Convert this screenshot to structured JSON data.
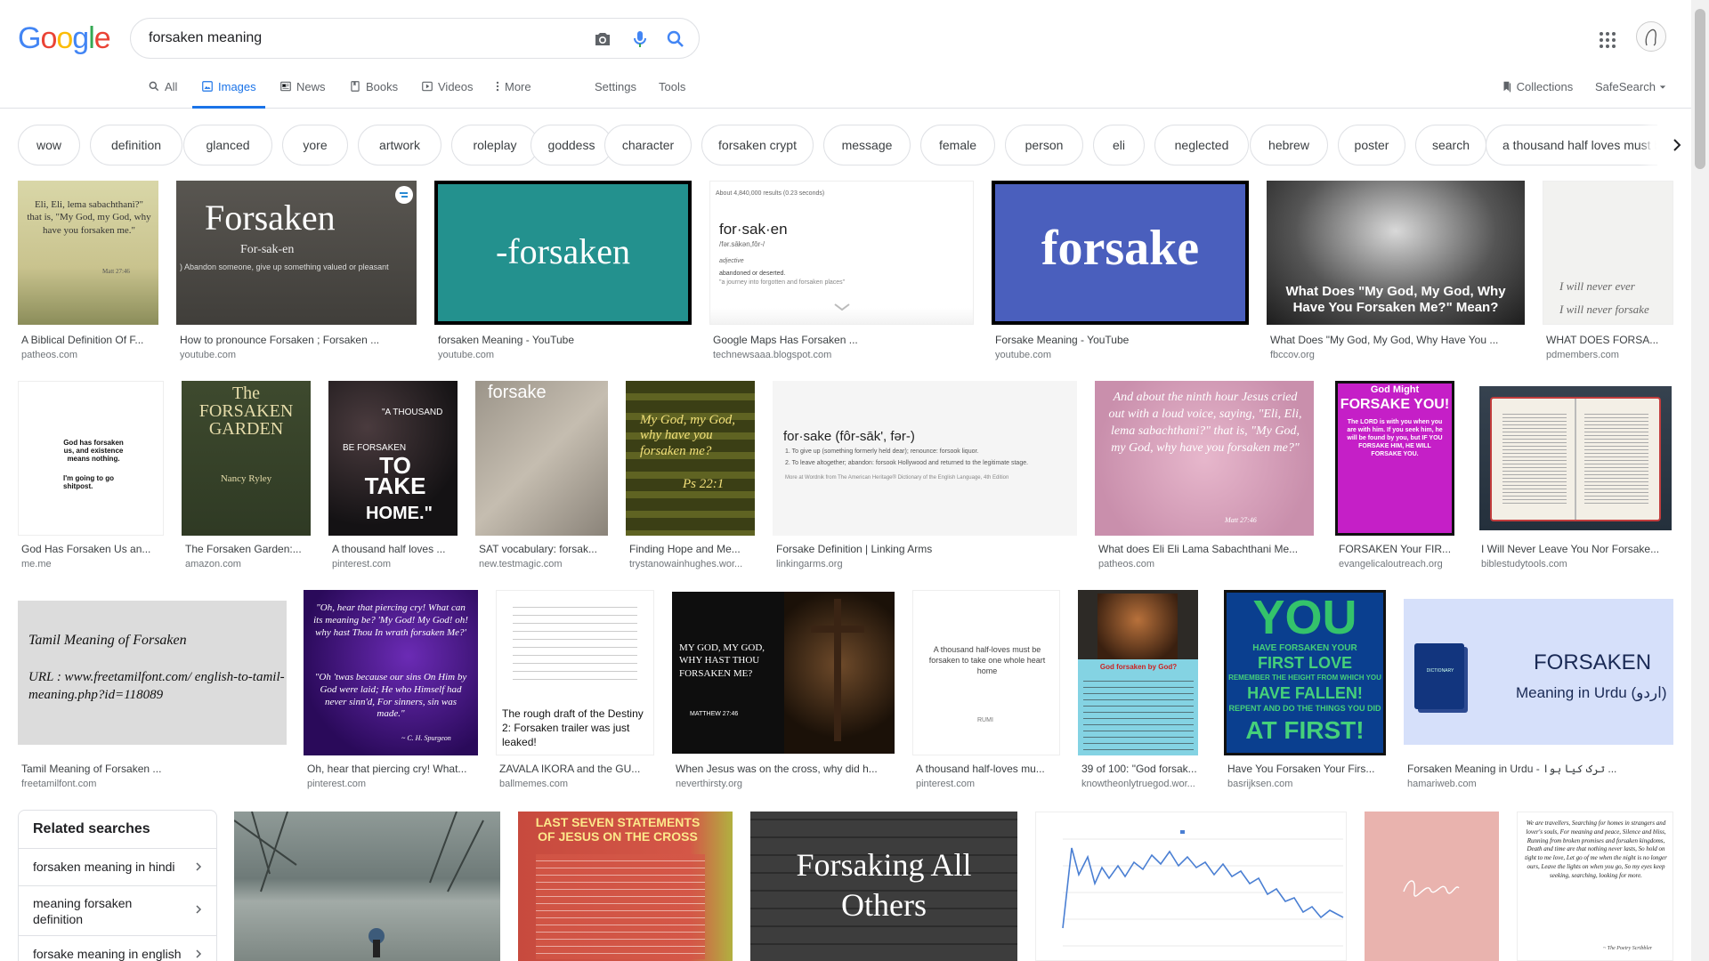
{
  "search": {
    "query": "forsaken meaning",
    "logo": "Google"
  },
  "tabs": [
    {
      "label": "All"
    },
    {
      "label": "Images"
    },
    {
      "label": "News"
    },
    {
      "label": "Books"
    },
    {
      "label": "Videos"
    },
    {
      "label": "More"
    },
    {
      "label": "Settings"
    },
    {
      "label": "Tools"
    }
  ],
  "toolbar": {
    "collections": "Collections",
    "safesearch": "SafeSearch"
  },
  "chips": [
    "wow",
    "definition",
    "glanced",
    "yore",
    "artwork",
    "roleplay",
    "goddess",
    "character",
    "forsaken crypt",
    "message",
    "female",
    "person",
    "eli",
    "neglected",
    "hebrew",
    "poster",
    "search",
    "a thousand half loves must b"
  ],
  "results": [
    {
      "caption": "A Biblical Definition Of F...",
      "source": "patheos.com",
      "text": "Eli, Eli, lema sabachthani?\" that is, \"My God, my God, why have you forsaken me.\"",
      "text2": "Matt 27:46"
    },
    {
      "caption": "How to pronounce Forsaken ; Forsaken ...",
      "source": "youtube.com",
      "text": "Forsaken",
      "text2": "For-sak-en",
      "text3": ") Abandon someone, give up something valued or pleasant"
    },
    {
      "caption": "forsaken Meaning - YouTube",
      "source": "youtube.com",
      "text": "-forsaken"
    },
    {
      "caption": "Google Maps Has Forsaken ...",
      "source": "technewsaaa.blogspot.com",
      "text": "for·sak·en",
      "text2": "About 4,840,000 results (0.23 seconds)",
      "text3": "/fər.sākən,fôr-/",
      "text4": "adjective",
      "text5": "abandoned or deserted.",
      "text6": "\"a journey into forgotten and forsaken places\""
    },
    {
      "caption": "Forsake Meaning - YouTube",
      "source": "youtube.com",
      "text": "forsake"
    },
    {
      "caption": "What Does \"My God, My God, Why Have You ...",
      "source": "fbccov.org",
      "text": "What Does \"My God, My God, Why Have You Forsaken Me?\" Mean?"
    },
    {
      "caption": "WHAT DOES FORSA...",
      "source": "pdmembers.com",
      "text": "I will never ever",
      "text2": "I will never forsake"
    },
    {
      "caption": "God Has Forsaken Us an...",
      "source": "me.me",
      "text": "God has forsaken us, and existence means nothing.",
      "text2": "I'm going to go shitpost."
    },
    {
      "caption": "The Forsaken Garden:...",
      "source": "amazon.com",
      "text": "The FORSAKEN GARDEN",
      "text2": "Nancy Ryley"
    },
    {
      "caption": "A thousand half loves ...",
      "source": "pinterest.com",
      "text": "\"A THOUSAND",
      "text2": "BE FORSAKEN",
      "text3": "TO TAKE",
      "text4": "HOME.\""
    },
    {
      "caption": "SAT vocabulary: forsak...",
      "source": "new.testmagic.com",
      "text": "forsake"
    },
    {
      "caption": "Finding Hope and Me...",
      "source": "trystanowainhughes.wor...",
      "text": "My God, my God, why have you forsaken me?",
      "text2": "Ps 22:1"
    },
    {
      "caption": "Forsake Definition | Linking Arms",
      "source": "linkingarms.org",
      "text": "for·sake (fôr-sāk', fər-)",
      "text2": "1. To give up (something formerly held dear); renounce: forsook liquor.",
      "text3": "2. To leave altogether; abandon: forsook Hollywood and returned to the legitimate stage.",
      "text4": "More at Wordnik   from The American Heritage® Dictionary of the English Language, 4th Edition"
    },
    {
      "caption": "What does Eli Eli Lama Sabachthani Me...",
      "source": "patheos.com",
      "text": "And about the ninth hour Jesus cried out with a loud voice, saying, \"Eli, Eli, lema sabachthani?\" that is, \"My God, my God, why have you forsaken me?\"",
      "text2": "Matt 27:46"
    },
    {
      "caption": "FORSAKEN Your FIR...",
      "source": "evangelicaloutreach.org",
      "text": "God Might",
      "text2": "FORSAKE YOU!",
      "text3": "The LORD is with you when you are with him. If you seek him, he will be found by you, but IF YOU FORSAKE HIM, HE WILL FORSAKE YOU."
    },
    {
      "caption": "I Will Never Leave You Nor Forsake...",
      "source": "biblestudytools.com"
    },
    {
      "caption": "Tamil Meaning of Forsaken ...",
      "source": "freetamilfont.com",
      "text": "Tamil Meaning of Forsaken",
      "text2": "URL : www.freetamilfont.com/ english-to-tamil-meaning.php?id=118089"
    },
    {
      "caption": "Oh, hear that piercing cry! What...",
      "source": "pinterest.com",
      "text": "\"Oh, hear that piercing cry! What can its meaning be? 'My God! My God! oh! why hast Thou In wrath forsaken Me?'",
      "text2": "\"Oh 'twas because our sins On Him by God were laid; He who Himself had never sinn'd, For sinners, sin was made.\"",
      "text3": "~ C. H. Spurgeon"
    },
    {
      "caption": "ZAVALA IKORA and the GU...",
      "source": "ballmemes.com",
      "text": "The rough draft of the Destiny 2: Forsaken trailer was just leaked!"
    },
    {
      "caption": "When Jesus was on the cross, why did h...",
      "source": "neverthirsty.org",
      "text": "MY GOD, MY GOD, WHY HAST THOU FORSAKEN ME?",
      "text2": "MATTHEW 27:46"
    },
    {
      "caption": "A thousand half-loves mu...",
      "source": "pinterest.com",
      "text": "A thousand half-loves must be forsaken to take one whole heart home",
      "text2": "RUMI"
    },
    {
      "caption": "39 of 100: \"God forsak...",
      "source": "knowtheonlytruegod.wor...",
      "text": "God forsaken by God?"
    },
    {
      "caption": "Have You Forsaken Your Firs...",
      "source": "basrijksen.com",
      "text": "YOU",
      "text2": "HAVE FORSAKEN YOUR",
      "text3": "FIRST LOVE",
      "text4": "REMEMBER THE HEIGHT FROM WHICH YOU",
      "text5": "HAVE FALLEN!",
      "text6": "REPENT AND DO THE THINGS YOU DID",
      "text7": "AT FIRST!"
    },
    {
      "caption": "Forsaken Meaning in Urdu - ترک کیا ہوا ...",
      "source": "hamariweb.com",
      "text": "FORSAKEN",
      "text2": "Meaning in Urdu (اردو)",
      "text3": "DICTIONARY"
    },
    {
      "text": "LAST SEVEN STATEMENTS OF JESUS ON THE CROSS"
    },
    {
      "text": "Forsaking All Others"
    },
    {
      "text": "We are travellers, Searching for homes in strangers and lover's souls, For meaning and peace, Silence and bliss, Running from broken promises and forsaken kingdoms, Death and time are that nothing never lasts, So hold on tight to me love, Let go of me when the night is no longer ours, Leave the lights on when you go, So my eyes keep seeking, searching, looking for more.",
      "text2": "~ The Poetry Scribbler"
    }
  ],
  "related": {
    "title": "Related searches",
    "items": [
      "forsaken meaning in hindi",
      "meaning forsaken definition",
      "forsake meaning in english"
    ]
  },
  "colors": {
    "accent": "#1a73e8",
    "google_blue": "#4285f4",
    "google_red": "#ea4335",
    "google_yellow": "#fbbc05",
    "google_green": "#34a853"
  }
}
